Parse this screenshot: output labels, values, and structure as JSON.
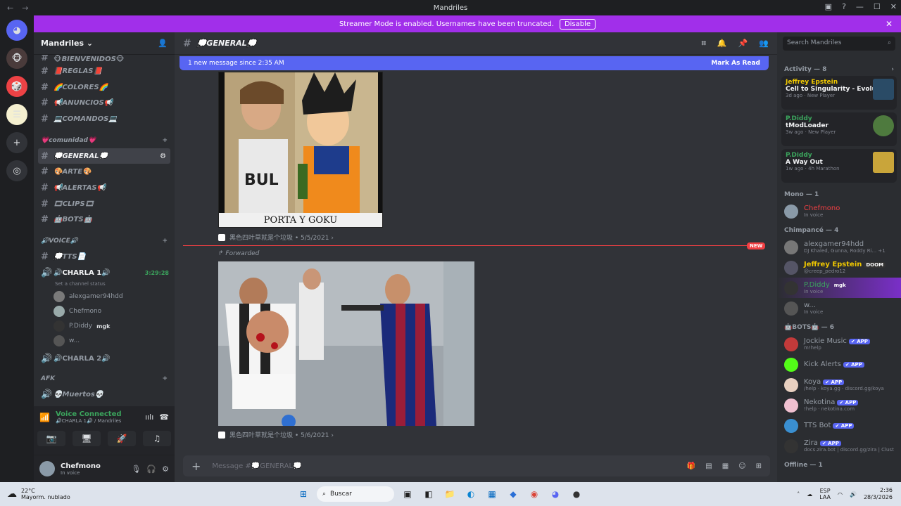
{
  "window": {
    "title": "Mandriles"
  },
  "banner": {
    "text": "Streamer Mode is enabled. Usernames have been truncated.",
    "button": "Disable"
  },
  "server": {
    "name": "Mandriles"
  },
  "channels": {
    "top": [
      "🐵BIENVENIDOS🐵",
      "📕REGLAS📕",
      "🌈COLORES🌈",
      "📢ANUNCIOS📢",
      "💻COMANDOS💻"
    ],
    "community_label": "💗comunidad💗",
    "community": [
      "💭GENERAL💭",
      "🎨ARTE🎨",
      "📢ALERTAS📢",
      "🎞CLIPS🎞",
      "🤖BOTS🤖"
    ],
    "voice_label": "🔊VOICE🔊",
    "tts": "💭TTS📄",
    "charla1": "🔊CHARLA 1🔊",
    "charla1_time": "3:29:28",
    "charla1_status": "Set a channel status",
    "voice_users": [
      "alexgamer94hdd",
      "Chefmono",
      "P.Diddy",
      "w..."
    ],
    "pdiddy_badge": "mgk",
    "charla2": "🔊CHARLA 2🔊",
    "afk_label": "AFK",
    "muertos": "💀Muertos💀"
  },
  "voice_panel": {
    "status": "Voice Connected",
    "location": "🔊CHARLA 1🔊 / Mandriles"
  },
  "user_panel": {
    "name": "Chefmono",
    "status": "In voice"
  },
  "main": {
    "channel_title": "💭GENERAL💭",
    "new_msg": "1 new message since 2:35 AM",
    "mark_read": "Mark As Read",
    "img1_caption": "PORTA Y GOKU",
    "meta1": "黑色四叶草就是个垃圾 • 5/5/2021 ›",
    "new_tag": "NEW",
    "forwarded": "↱ Forwarded",
    "meta2": "黑色四叶草就是个垃圾 • 5/6/2021 ›",
    "composer_placeholder": "Message #💭GENERAL💭"
  },
  "members": {
    "search_placeholder": "Search Mandriles",
    "activity_label": "Activity — 8",
    "activities": [
      {
        "user": "Jeffrey Epstein",
        "game": "Cell to Singularity - Evoluti...",
        "time": "3d ago",
        "tag": "New Player",
        "color": "#f0c800"
      },
      {
        "user": "P.Diddy",
        "game": "tModLoader",
        "time": "3w ago",
        "tag": "New Player",
        "color": "#3ba55d"
      },
      {
        "user": "P.Diddy",
        "game": "A Way Out",
        "time": "1w ago",
        "tag": "4h Marathon",
        "color": "#3ba55d"
      }
    ],
    "mono_label": "Mono — 1",
    "mono": [
      {
        "name": "Chefmono",
        "sub": "In voice",
        "color": "#f23f43"
      }
    ],
    "chimp_label": "Chimpancé — 4",
    "chimp": [
      {
        "name": "alexgamer94hdd",
        "sub": "DJ Khaled, Gunna, Roddy Ri... +1",
        "color": "#949ba4"
      },
      {
        "name": "Jeffrey Epstein",
        "sub": "@creep_pedro12",
        "color": "#f0c800",
        "badge": "DOOM"
      },
      {
        "name": "P.Diddy",
        "sub": "In voice",
        "color": "#3ba55d",
        "badge": "mgk"
      },
      {
        "name": "w...",
        "sub": "In voice",
        "color": "#949ba4"
      }
    ],
    "bots_label": "🤖BOTS🤖 — 6",
    "bots": [
      {
        "name": "Jockie Music",
        "sub": "m!help"
      },
      {
        "name": "Kick Alerts",
        "sub": ""
      },
      {
        "name": "Koya",
        "sub": "/help · koya.gg · discord.gg/koya"
      },
      {
        "name": "Nekotina",
        "sub": "!help · nekotina.com"
      },
      {
        "name": "TTS Bot",
        "sub": ""
      },
      {
        "name": "Zira",
        "sub": "docs.zira.bot | discord.gg/zira | Clust"
      }
    ],
    "app_badge": "✔ APP",
    "offline_label": "Offline — 1"
  },
  "taskbar": {
    "weather_temp": "22°C",
    "weather_desc": "Mayorm. nublado",
    "search": "Buscar",
    "lang1": "ESP",
    "lang2": "LAA",
    "time": "2:36",
    "date": "28/3/2026"
  }
}
